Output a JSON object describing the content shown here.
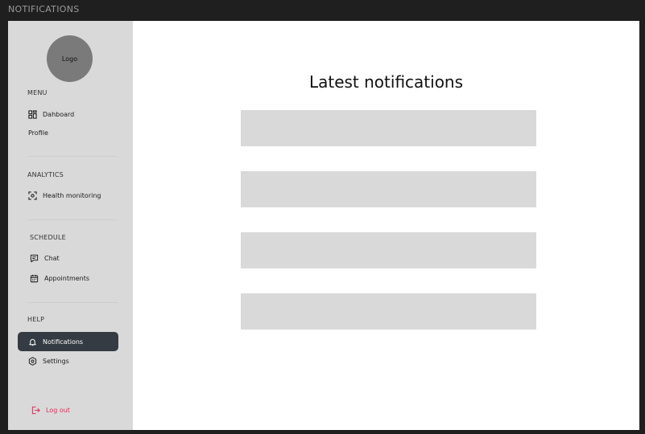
{
  "window": {
    "title": "NOTIFICATIONS"
  },
  "sidebar": {
    "logo_text": "Logo",
    "sections": {
      "menu": "MENU",
      "analytics": "ANALYTICS",
      "schedule": "SCHEDULE",
      "help": "HELP"
    },
    "items": {
      "dashboard": "Dahboard",
      "profile": "Profile",
      "health": "Health monitoring",
      "chat": "Chat",
      "appointments": "Appointments",
      "notifications": "Notifications",
      "settings": "Settings",
      "logout": "Log out"
    },
    "active_item": "Notifications",
    "colors": {
      "active_bg": "#343b42",
      "logout": "#d6335a",
      "sidebar_bg": "#d9d9d9"
    }
  },
  "main": {
    "title": "Latest notifications",
    "notification_count": 4
  }
}
